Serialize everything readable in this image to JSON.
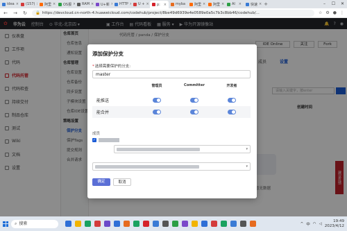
{
  "browser": {
    "tabs": [
      {
        "label": "idea",
        "color": "#3a7bd5"
      },
      {
        "label": "(157)",
        "color": "#d33b3b"
      },
      {
        "label": "阿里",
        "color": "#ff6a00"
      },
      {
        "label": "OS报",
        "color": "#2c9f45"
      },
      {
        "label": "RAM",
        "color": "#5a5a5a"
      },
      {
        "label": "U+新",
        "color": "#7b49c9"
      },
      {
        "label": "HTTP",
        "color": "#3a7bd5"
      },
      {
        "label": "U + ",
        "color": "#d33b3b"
      },
      {
        "label": "p:",
        "color": "#d5222a",
        "active": true
      },
      {
        "label": "myba",
        "color": "#e66b1f"
      },
      {
        "label": "阿里",
        "color": "#ff6a00"
      },
      {
        "label": "阿里",
        "color": "#ff6a00"
      },
      {
        "label": "AI",
        "color": "#2c9f45"
      },
      {
        "label": "快速",
        "color": "#3a7bd5"
      }
    ],
    "url": "https://devcloud.cn-north-4.huaweicloud.com/codehub/project/8be49d6939e4e0589e0a5c7b3c8bb46/codehub/..."
  },
  "header": {
    "brand": "华为云",
    "console": "控制台",
    "region": "华北-北京四",
    "workbench": "工作台",
    "codehub_board": "代码看板",
    "services": "服务",
    "huawei_open_source": "华为开源镜像站"
  },
  "sidebar": {
    "items": [
      {
        "label": "仪表盘"
      },
      {
        "label": "工作项"
      },
      {
        "label": "代码"
      },
      {
        "label": "代码托管",
        "active": true
      },
      {
        "label": "代码检查"
      },
      {
        "label": "持续交付"
      },
      {
        "label": "制品仓库"
      },
      {
        "label": "测试"
      },
      {
        "label": "Wiki"
      },
      {
        "label": "文档"
      },
      {
        "label": "设置"
      }
    ]
  },
  "subsidebar": {
    "items": [
      {
        "label": "仓库首页",
        "group": true
      },
      {
        "label": "仓库信息"
      },
      {
        "label": "通知设置"
      },
      {
        "label": "仓库管理",
        "group": true
      },
      {
        "label": "仓库设置"
      },
      {
        "label": "仓库备份"
      },
      {
        "label": "同步设置"
      },
      {
        "label": "子模块设置"
      },
      {
        "label": "仓库IDE设置"
      },
      {
        "label": "策略设置",
        "group": true
      },
      {
        "label": "保护分支",
        "active": true
      },
      {
        "label": "保护Tags"
      },
      {
        "label": "提交规则"
      },
      {
        "label": "合并请求"
      }
    ]
  },
  "main": {
    "breadcrumb": "代码托管 / panda / 保护分支",
    "ide_online": "IDE Online",
    "follow": "关注",
    "fork": "Fork",
    "tab_members": "成员",
    "tab_settings": "设置",
    "search_placeholder": "请输入关键字，按enter",
    "col_time": "创建时间",
    "no_data": "暂无数据"
  },
  "modal": {
    "title": "添加保护分支",
    "branch_label": "选择需要保护的分支:",
    "branch_value": "master",
    "columns": [
      "",
      "管理员",
      "Committer",
      "开发者"
    ],
    "rows": [
      {
        "label": "能推送",
        "admin": true,
        "committer": true,
        "developer": true
      },
      {
        "label": "能合并",
        "admin": true,
        "committer": true,
        "developer": true
      }
    ],
    "members_label": "成员",
    "confirm": "确定",
    "cancel": "取消"
  },
  "feedback": "建议反馈",
  "taskbar": {
    "search": "搜索",
    "time": "19:49",
    "date": "2023/4/12",
    "lang": "中"
  }
}
